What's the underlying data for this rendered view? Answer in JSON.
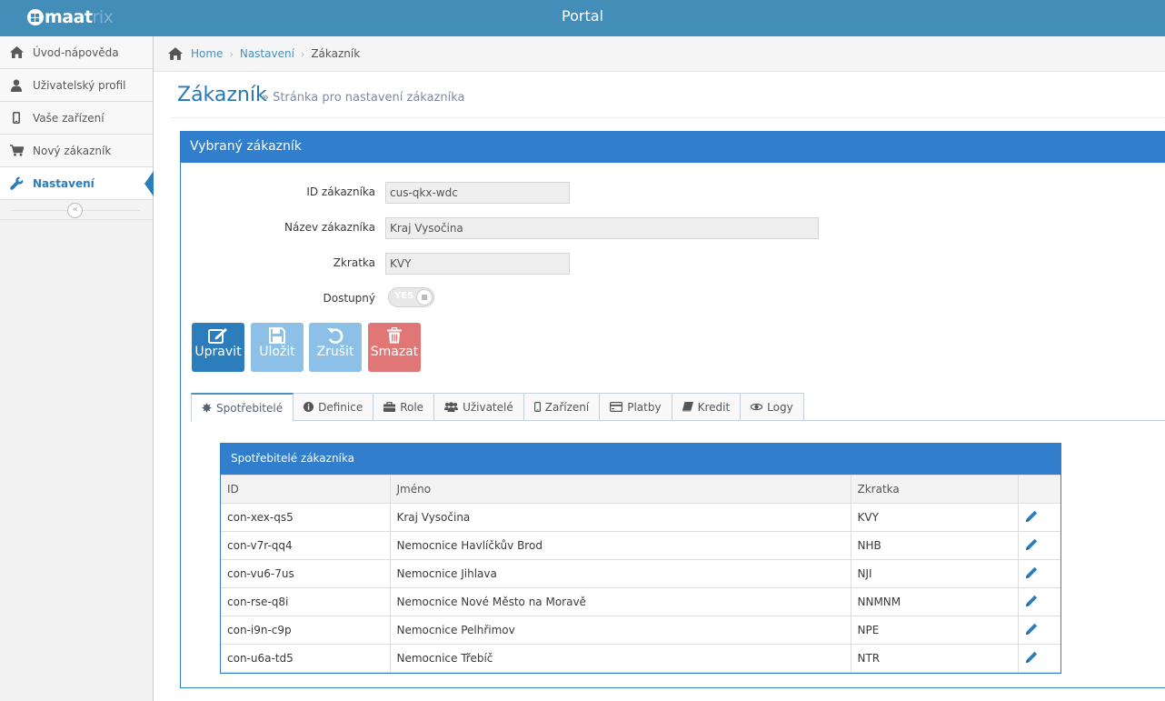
{
  "navbar": {
    "logo_text_main": "maat",
    "logo_text_dim": "rix",
    "title": "Portal"
  },
  "sidebar": {
    "items": [
      {
        "label": "Úvod-nápověda",
        "icon": "home-icon"
      },
      {
        "label": "Uživatelský profil",
        "icon": "user-icon"
      },
      {
        "label": "Vaše zařízení",
        "icon": "mobile-icon"
      },
      {
        "label": "Nový zákazník",
        "icon": "cart-icon"
      },
      {
        "label": "Nastavení",
        "icon": "wrench-icon",
        "active": true
      }
    ],
    "collapse_glyph": "«"
  },
  "breadcrumbs": {
    "home": "Home",
    "settings": "Nastavení",
    "current": "Zákazník"
  },
  "page_header": {
    "title": "Zákazník",
    "subtitle": "» Stránka pro nastavení zákazníka"
  },
  "widget": {
    "title": "Vybraný zákazník",
    "fields": {
      "id_label": "ID zákazníka",
      "id_value": "cus-qkx-wdc",
      "name_label": "Název zákazníka",
      "name_value": "Kraj Vysočina",
      "abbr_label": "Zkratka",
      "abbr_value": "KVY",
      "available_label": "Dostupný",
      "available_value": "YES"
    },
    "buttons": {
      "edit": "Upravit",
      "save": "Uložit",
      "cancel": "Zrušit",
      "delete": "Smazat"
    }
  },
  "tabs": [
    {
      "label": "Spotřebitelé",
      "active": true
    },
    {
      "label": "Definice"
    },
    {
      "label": "Role"
    },
    {
      "label": "Uživatelé"
    },
    {
      "label": "Zařízení"
    },
    {
      "label": "Platby"
    },
    {
      "label": "Kredit"
    },
    {
      "label": "Logy"
    }
  ],
  "consumers": {
    "title": "Spotřebitelé zákazníka",
    "columns": [
      "ID",
      "Jméno",
      "Zkratka"
    ],
    "rows": [
      {
        "id": "con-xex-qs5",
        "name": "Kraj Vysočina",
        "abbr": "KVY"
      },
      {
        "id": "con-v7r-qq4",
        "name": "Nemocnice Havlíčkův Brod",
        "abbr": "NHB"
      },
      {
        "id": "con-vu6-7us",
        "name": "Nemocnice Jihlava",
        "abbr": "NJI"
      },
      {
        "id": "con-rse-q8i",
        "name": "Nemocnice Nové Město na Moravě",
        "abbr": "NNMNM"
      },
      {
        "id": "con-i9n-c9p",
        "name": "Nemocnice Pelhřimov",
        "abbr": "NPE"
      },
      {
        "id": "con-u6a-td5",
        "name": "Nemocnice Třebíč",
        "abbr": "NTR"
      }
    ]
  },
  "colors": {
    "navbar": "#438eb9",
    "widget_header": "#307ecc",
    "primary_button": "#2b7dbc",
    "disabled_button": "#8dc0e6",
    "danger_button": "#e17676",
    "link": "#4c8fbd"
  }
}
